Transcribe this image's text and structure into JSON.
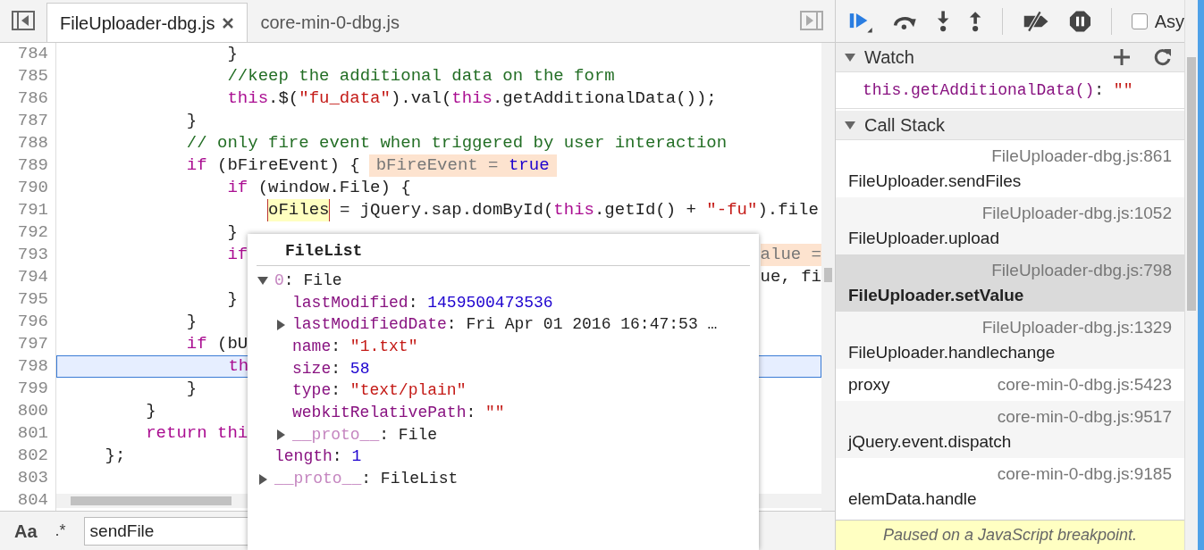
{
  "editor": {
    "tabs": [
      {
        "label": "FileUploader-dbg.js",
        "selected": true,
        "closable": true
      },
      {
        "label": "core-min-0-dbg.js",
        "selected": false,
        "closable": false
      }
    ],
    "lines": [
      {
        "number": "784",
        "current": false,
        "tokens": [
          {
            "kind": "plain",
            "text": "                }"
          }
        ]
      },
      {
        "number": "785",
        "current": false,
        "tokens": [
          {
            "kind": "comment",
            "text": "                //keep the additional data on the form"
          }
        ]
      },
      {
        "number": "786",
        "current": false,
        "tokens": [
          {
            "kind": "keyword",
            "text": "                this"
          },
          {
            "kind": "plain",
            "text": ".$("
          },
          {
            "kind": "string",
            "text": "\"fu_data\""
          },
          {
            "kind": "plain",
            "text": ").val("
          },
          {
            "kind": "keyword",
            "text": "this"
          },
          {
            "kind": "plain",
            "text": ".getAdditionalData());"
          }
        ]
      },
      {
        "number": "787",
        "current": false,
        "tokens": [
          {
            "kind": "plain",
            "text": "            }"
          }
        ]
      },
      {
        "number": "788",
        "current": false,
        "tokens": [
          {
            "kind": "comment",
            "text": "            // only fire event when triggered by user interaction"
          }
        ]
      },
      {
        "number": "789",
        "current": false,
        "tokens": [
          {
            "kind": "keyword",
            "text": "            if"
          },
          {
            "kind": "plain",
            "text": " (bFireEvent) {"
          }
        ],
        "inline_value": {
          "name": "bFireEvent = ",
          "value": "true"
        }
      },
      {
        "number": "790",
        "current": false,
        "tokens": [
          {
            "kind": "keyword",
            "text": "                if"
          },
          {
            "kind": "plain",
            "text": " (window.File) {"
          }
        ]
      },
      {
        "number": "791",
        "current": false,
        "tokens": [
          {
            "kind": "hovered",
            "text": "                    oFiles"
          },
          {
            "kind": "plain",
            "text": " = jQuery.sap.domById("
          },
          {
            "kind": "keyword",
            "text": "this"
          },
          {
            "kind": "plain",
            "text": ".getId() + "
          },
          {
            "kind": "string",
            "text": "\"-fu\""
          },
          {
            "kind": "plain",
            "text": ").file"
          }
        ]
      },
      {
        "number": "792",
        "current": false,
        "tokens": [
          {
            "kind": "plain",
            "text": "                }"
          }
        ]
      },
      {
        "number": "793",
        "current": false,
        "tokens": [
          {
            "kind": "keyword",
            "text": "                if"
          }
        ],
        "right_tokens": [
          {
            "kind": "inline",
            "text": "alue ="
          }
        ]
      },
      {
        "number": "794",
        "current": false,
        "right_tokens": [
          {
            "kind": "plain",
            "text": "ue, fi"
          }
        ]
      },
      {
        "number": "795",
        "current": false,
        "tokens": [
          {
            "kind": "plain",
            "text": "                }"
          }
        ]
      },
      {
        "number": "796",
        "current": false,
        "tokens": [
          {
            "kind": "plain",
            "text": "            }"
          }
        ]
      },
      {
        "number": "797",
        "current": false,
        "tokens": [
          {
            "kind": "keyword",
            "text": "            if"
          },
          {
            "kind": "plain",
            "text": " (bU"
          }
        ]
      },
      {
        "number": "798",
        "current": true,
        "tokens": [
          {
            "kind": "keyword",
            "text": "                th"
          }
        ]
      },
      {
        "number": "799",
        "current": false,
        "tokens": [
          {
            "kind": "plain",
            "text": "            }"
          }
        ]
      },
      {
        "number": "800",
        "current": false,
        "tokens": [
          {
            "kind": "plain",
            "text": "        }"
          }
        ]
      },
      {
        "number": "801",
        "current": false,
        "tokens": [
          {
            "kind": "keyword",
            "text": "        return thi"
          }
        ]
      },
      {
        "number": "802",
        "current": false,
        "tokens": [
          {
            "kind": "plain",
            "text": "    };"
          }
        ]
      },
      {
        "number": "803",
        "current": false
      },
      {
        "number": "804",
        "current": false
      }
    ],
    "popover": {
      "title": "FileList",
      "tree": [
        {
          "key": "0",
          "dimmed": true,
          "separator": ":",
          "value": "File",
          "kind": "object",
          "expanded": true,
          "children": [
            {
              "key": "lastModified",
              "dimmed": false,
              "separator": ":",
              "value": "1459500473536",
              "kind": "number"
            },
            {
              "key": "lastModifiedDate",
              "dimmed": false,
              "separator": ":",
              "value": "Fri Apr 01 2016 16:47:53 …",
              "kind": "object",
              "expanded": false
            },
            {
              "key": "name",
              "dimmed": false,
              "separator": ":",
              "value": "\"1.txt\"",
              "kind": "string"
            },
            {
              "key": "size",
              "dimmed": false,
              "separator": ":",
              "value": "58",
              "kind": "number"
            },
            {
              "key": "type",
              "dimmed": false,
              "separator": ":",
              "value": "\"text/plain\"",
              "kind": "string"
            },
            {
              "key": "webkitRelativePath",
              "dimmed": false,
              "separator": ":",
              "value": "\"\"",
              "kind": "string"
            },
            {
              "key": "__proto__",
              "dimmed": true,
              "separator": ":",
              "value": "File",
              "kind": "object",
              "expanded": false
            }
          ]
        },
        {
          "key": "length",
          "dimmed": false,
          "separator": ":",
          "value": "1",
          "kind": "number"
        },
        {
          "key": "__proto__",
          "dimmed": true,
          "separator": ":",
          "value": "FileList",
          "kind": "object",
          "expanded": false
        }
      ]
    },
    "search": {
      "match_case": "Aa",
      "regex": ".*",
      "value": "sendFile"
    }
  },
  "debugger": {
    "async": {
      "label": "Asy",
      "checked": false
    },
    "watch": {
      "title": "Watch",
      "expanded": true,
      "items": [
        {
          "expression": "this.getAdditionalData()",
          "separator": ":",
          "value": "\"\""
        }
      ]
    },
    "call_stack": {
      "title": "Call Stack",
      "expanded": true,
      "frames": [
        {
          "function": "FileUploader.sendFiles",
          "location": "FileUploader-dbg.js:861",
          "selected": false
        },
        {
          "function": "FileUploader.upload",
          "location": "FileUploader-dbg.js:1052",
          "selected": false
        },
        {
          "function": "FileUploader.setValue",
          "location": "FileUploader-dbg.js:798",
          "selected": true
        },
        {
          "function": "FileUploader.handlechange",
          "location": "FileUploader-dbg.js:1329",
          "selected": false
        },
        {
          "function": "proxy",
          "location": "core-min-0-dbg.js:5423",
          "selected": false
        },
        {
          "function": "jQuery.event.dispatch",
          "location": "core-min-0-dbg.js:9517",
          "selected": false
        },
        {
          "function": "elemData.handle",
          "location": "core-min-0-dbg.js:9185",
          "selected": false
        }
      ]
    },
    "status": "Paused on a JavaScript breakpoint."
  }
}
